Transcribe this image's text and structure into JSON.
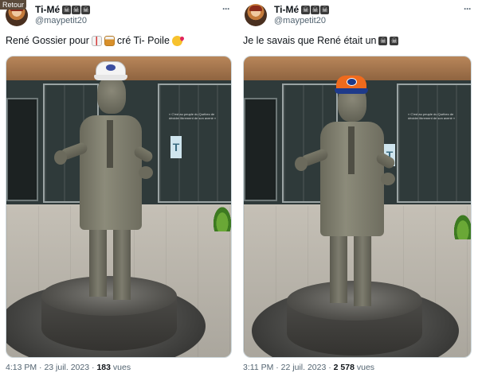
{
  "back_badge": "Retour",
  "posts": [
    {
      "author": {
        "name": "Ti-Mé",
        "handle": "@maypetit20",
        "name_emojis": [
          "skull-crossbones-icon",
          "skull-crossbones-icon",
          "skull-crossbones-icon"
        ]
      },
      "text": {
        "part1": "René Gossier pour",
        "part2": "cré Ti- Poile"
      },
      "text_emojis": [
        "bottle-icon",
        "whisky-glass-icon",
        "kiss-face-icon"
      ],
      "image": {
        "subject": "statue-with-white-cap",
        "sign_text": "« C'est au peuple du Québec de décider librement de son avenir »"
      },
      "meta": {
        "time": "4:13 PM",
        "separator": "·",
        "date": "23 juil. 2023",
        "views_count": "183",
        "views_label": "vues"
      }
    },
    {
      "author": {
        "name": "Ti-Mé",
        "handle": "@maypetit20",
        "name_emojis": [
          "skull-crossbones-icon",
          "skull-crossbones-icon",
          "skull-crossbones-icon"
        ]
      },
      "text": {
        "part1": "Je le savais que René était un"
      },
      "text_emojis": [
        "skull-crossbones-icon",
        "skull-crossbones-icon"
      ],
      "image": {
        "subject": "statue-with-orange-cap",
        "sign_text": "« C'est au peuple du Québec de décider librement de son avenir »"
      },
      "meta": {
        "time": "3:11 PM",
        "separator": "·",
        "date": "22 juil. 2023",
        "views_count": "2 578",
        "views_label": "vues"
      }
    }
  ],
  "more_label": "···",
  "skull_glyph": "☠"
}
